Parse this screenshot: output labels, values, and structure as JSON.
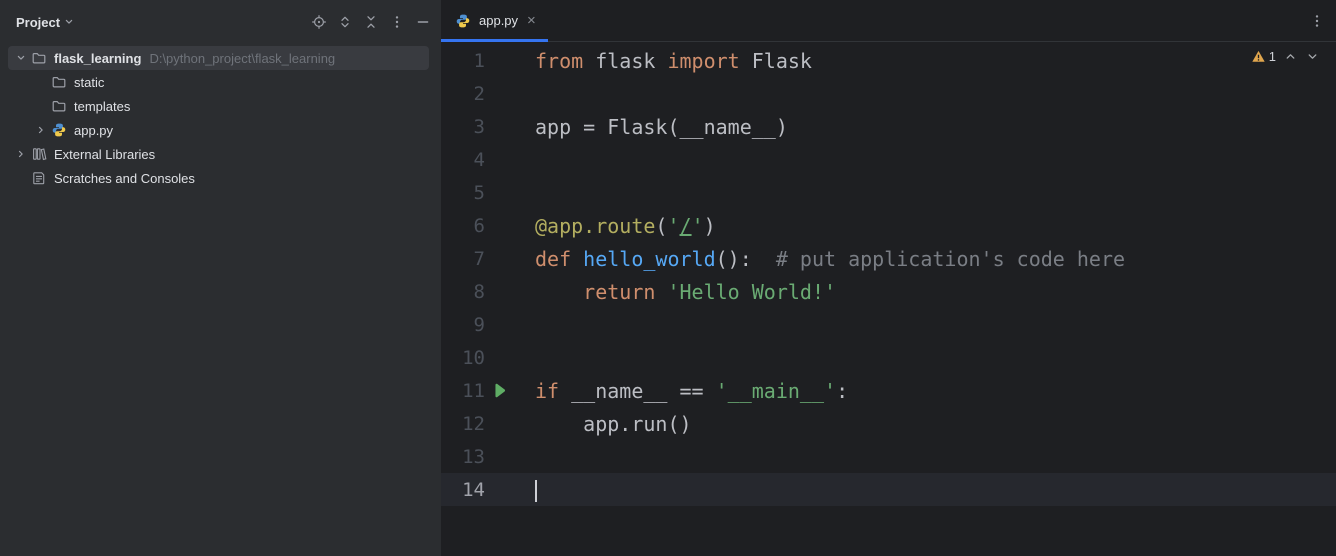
{
  "project_panel": {
    "title": "Project",
    "header_icons": [
      {
        "name": "select-opened-file-icon"
      },
      {
        "name": "expand-selection-icon"
      },
      {
        "name": "collapse-all-icon"
      },
      {
        "name": "more-options-icon"
      },
      {
        "name": "hide-panel-icon"
      }
    ],
    "tree": [
      {
        "id": "flask_learning",
        "label": "flask_learning",
        "path_suffix": "D:\\python_project\\flask_learning",
        "icon": "folder",
        "chevron": "down",
        "indent": 0,
        "selected": true,
        "root": true
      },
      {
        "id": "static",
        "label": "static",
        "icon": "folder",
        "chevron": null,
        "indent": 1,
        "selected": false
      },
      {
        "id": "templates",
        "label": "templates",
        "icon": "folder",
        "chevron": null,
        "indent": 1,
        "selected": false
      },
      {
        "id": "app-py",
        "label": "app.py",
        "icon": "python",
        "chevron": "right",
        "indent": 1,
        "selected": false
      },
      {
        "id": "external-libraries",
        "label": "External Libraries",
        "icon": "libraries",
        "chevron": "right",
        "indent": 0,
        "selected": false
      },
      {
        "id": "scratches-and-consoles",
        "label": "Scratches and Consoles",
        "icon": "scratches",
        "chevron": null,
        "indent": 0,
        "selected": false
      }
    ]
  },
  "tabs": [
    {
      "label": "app.py",
      "icon": "python",
      "active": true,
      "close_glyph": "×"
    }
  ],
  "editor": {
    "inspection": {
      "warning_count": "1"
    },
    "colors": {
      "keyword": "#cf8e6d",
      "string": "#6aab73",
      "comment": "#7a7e85",
      "function": "#56a8f5",
      "decorator": "#b3ae60",
      "accent_tab": "#3574f0",
      "run_icon": "#5fad65"
    },
    "lines": [
      {
        "num": 1,
        "tokens": [
          {
            "t": "from",
            "c": "kw"
          },
          {
            "t": " flask ",
            "c": "df"
          },
          {
            "t": "import",
            "c": "kw"
          },
          {
            "t": " Flask",
            "c": "df"
          }
        ]
      },
      {
        "num": 2,
        "tokens": []
      },
      {
        "num": 3,
        "tokens": [
          {
            "t": "app = Flask(__name__)",
            "c": "df"
          }
        ]
      },
      {
        "num": 4,
        "tokens": []
      },
      {
        "num": 5,
        "tokens": []
      },
      {
        "num": 6,
        "tokens": [
          {
            "t": "@app.route",
            "c": "dec"
          },
          {
            "t": "(",
            "c": "df"
          },
          {
            "t": "'",
            "c": "str"
          },
          {
            "t": "/",
            "c": "str u"
          },
          {
            "t": "'",
            "c": "str"
          },
          {
            "t": ")",
            "c": "df"
          }
        ]
      },
      {
        "num": 7,
        "tokens": [
          {
            "t": "def",
            "c": "kw"
          },
          {
            "t": " ",
            "c": "df"
          },
          {
            "t": "hello_world",
            "c": "fn"
          },
          {
            "t": "():  ",
            "c": "df"
          },
          {
            "t": "# put application's code here",
            "c": "cm"
          }
        ]
      },
      {
        "num": 8,
        "tokens": [
          {
            "t": "    ",
            "c": "df"
          },
          {
            "t": "return",
            "c": "kw"
          },
          {
            "t": " ",
            "c": "df"
          },
          {
            "t": "'Hello World!'",
            "c": "str"
          }
        ]
      },
      {
        "num": 9,
        "tokens": []
      },
      {
        "num": 10,
        "tokens": []
      },
      {
        "num": 11,
        "tokens": [
          {
            "t": "if",
            "c": "kw"
          },
          {
            "t": " __name__ == ",
            "c": "df"
          },
          {
            "t": "'__main__'",
            "c": "str"
          },
          {
            "t": ":",
            "c": "df"
          }
        ],
        "run": true
      },
      {
        "num": 12,
        "tokens": [
          {
            "t": "    app.run()",
            "c": "df"
          }
        ]
      },
      {
        "num": 13,
        "tokens": []
      },
      {
        "num": 14,
        "tokens": [],
        "caret": true
      }
    ]
  }
}
